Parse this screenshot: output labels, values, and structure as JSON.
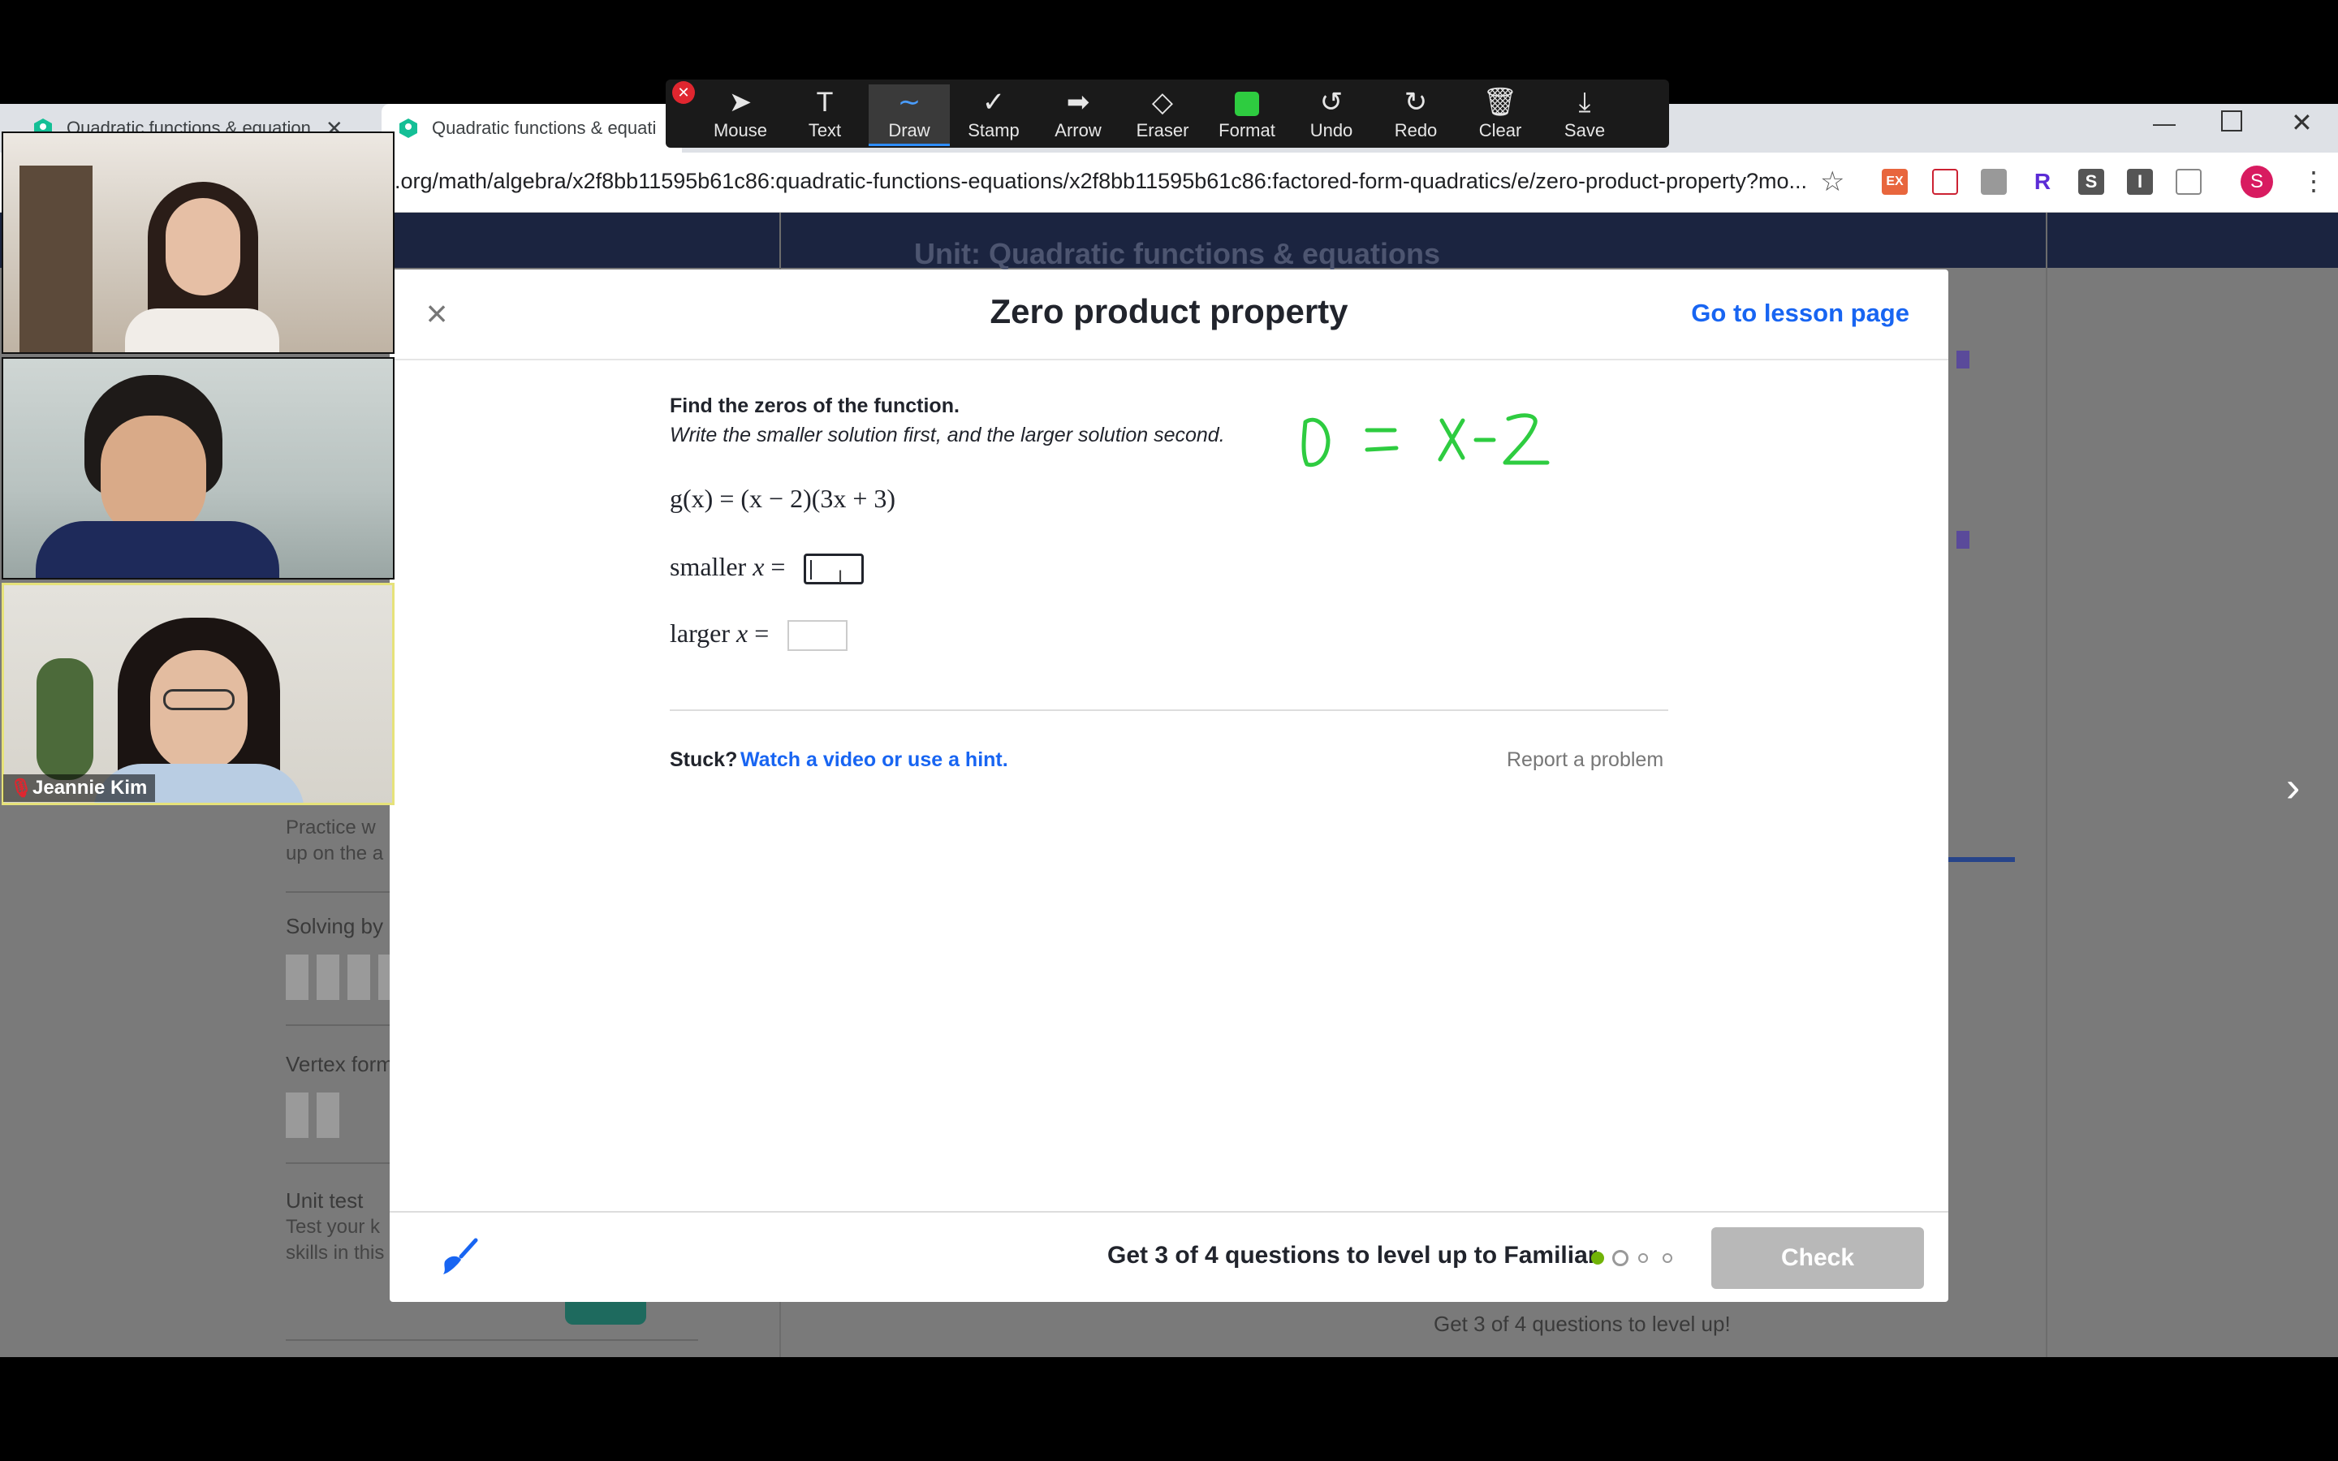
{
  "browser": {
    "tabs": [
      {
        "label": "Quadratic functions & equation"
      },
      {
        "label": "Quadratic functions & equati"
      }
    ],
    "url": ".org/math/algebra/x2f8bb11595b61c86:quadratic-functions-equations/x2f8bb11595b61c86:factored-form-quadratics/e/zero-product-property?mo...",
    "profile_initial": "S",
    "extensions": [
      "EX",
      "R",
      "S",
      "I"
    ]
  },
  "zoom_toolbar": {
    "tools": [
      {
        "label": "Mouse",
        "icon": "pointer-icon"
      },
      {
        "label": "Text",
        "icon": "text-icon"
      },
      {
        "label": "Draw",
        "icon": "draw-icon"
      },
      {
        "label": "Stamp",
        "icon": "checkmark-icon"
      },
      {
        "label": "Arrow",
        "icon": "arrow-icon"
      },
      {
        "label": "Eraser",
        "icon": "eraser-icon"
      },
      {
        "label": "Format",
        "icon": "format-swatch-icon"
      },
      {
        "label": "Undo",
        "icon": "undo-icon"
      },
      {
        "label": "Redo",
        "icon": "redo-icon"
      },
      {
        "label": "Clear",
        "icon": "trash-icon"
      },
      {
        "label": "Save",
        "icon": "save-icon"
      }
    ],
    "selected": "Draw",
    "format_color": "#2ecc40"
  },
  "participants": {
    "active_speaker_name": "Jeannie Kim"
  },
  "background_page": {
    "unit_title": "Unit: Quadratic functions & equations",
    "items": [
      {
        "title": "Practice w",
        "subtitle": "up on the a"
      },
      {
        "title": "Solving by",
        "subtitle": ""
      },
      {
        "title": "Vertex form",
        "subtitle": ""
      },
      {
        "title": "Unit test",
        "subtitle": "Test your k\nskills in this"
      }
    ],
    "right_footer": "Get 3 of 4 questions to level up!"
  },
  "exercise": {
    "title": "Zero product property",
    "lesson_link": "Go to lesson page",
    "prompt": "Find the zeros of the function.",
    "instruction": "Write the smaller solution first, and the larger solution second.",
    "function": "g(x) = (x − 2)(3x + 3)",
    "smaller_label": "smaller",
    "larger_label": "larger",
    "smaller_value": "",
    "larger_value": "",
    "stuck": "Stuck?",
    "hint_link": "Watch a video or use a hint.",
    "report": "Report a problem",
    "progress_message": "Get 3 of 4 questions to level up to Familiar",
    "progress_completed": 1,
    "progress_total": 4,
    "check_label": "Check",
    "annotation_color": "#2ecc40"
  }
}
